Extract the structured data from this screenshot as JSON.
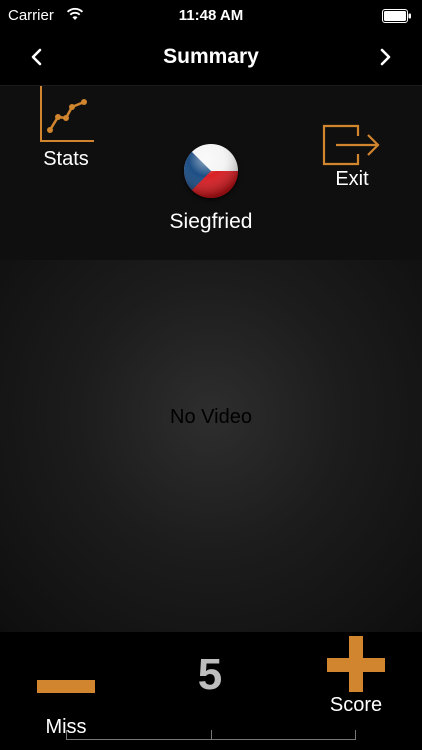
{
  "status_bar": {
    "carrier": "Carrier",
    "time": "11:48 AM"
  },
  "nav": {
    "title": "Summary"
  },
  "header": {
    "stats_label": "Stats",
    "player_name": "Siegfried",
    "exit_label": "Exit",
    "flag_colors": {
      "white": "#ffffff",
      "red": "#d7141a",
      "blue": "#11457e"
    }
  },
  "video": {
    "empty_text": "No Video"
  },
  "footer": {
    "miss_label": "Miss",
    "score_label": "Score",
    "score_value": "5"
  },
  "colors": {
    "accent": "#d0852e",
    "background": "#000000"
  }
}
